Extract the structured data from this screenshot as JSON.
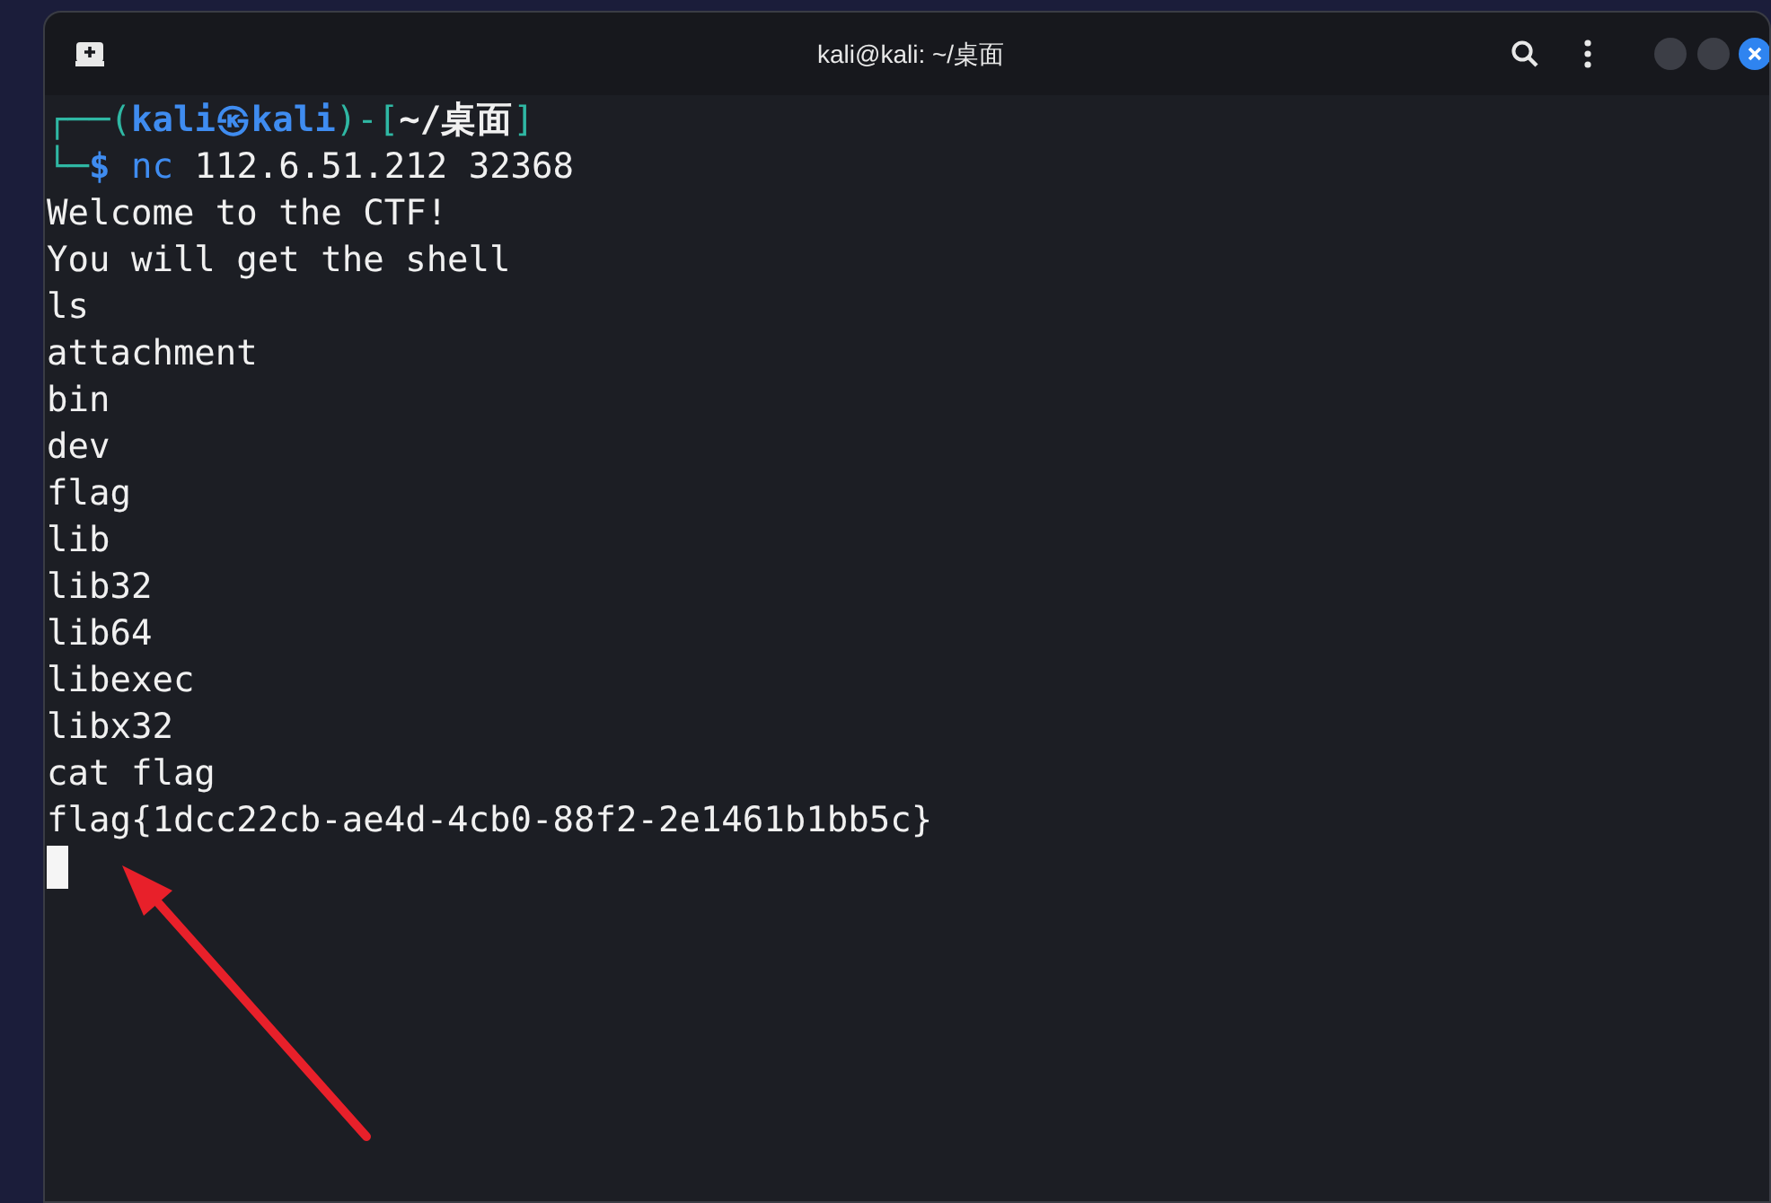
{
  "window": {
    "title": "kali@kali: ~/桌面"
  },
  "terminal": {
    "lines": [
      {
        "kind": "prompt",
        "segments": [
          {
            "text": "┌──(",
            "kind": "frame"
          },
          {
            "text": "kali㉿kali",
            "kind": "user"
          },
          {
            "text": ")-[",
            "kind": "frame"
          },
          {
            "text": "~/桌面",
            "kind": "path"
          },
          {
            "text": "]",
            "kind": "frame"
          }
        ]
      },
      {
        "kind": "prompt",
        "segments": [
          {
            "text": "└─",
            "kind": "frame"
          },
          {
            "text": "$",
            "kind": "user"
          },
          {
            "text": " nc",
            "kind": "command"
          },
          {
            "text": " 112.6.51.212 32368",
            "kind": "plain"
          }
        ]
      },
      {
        "kind": "output",
        "text": "Welcome to the CTF!"
      },
      {
        "kind": "output",
        "text": "You will get the shell"
      },
      {
        "kind": "output",
        "text": "ls"
      },
      {
        "kind": "output",
        "text": "attachment"
      },
      {
        "kind": "output",
        "text": "bin"
      },
      {
        "kind": "output",
        "text": "dev"
      },
      {
        "kind": "output",
        "text": "flag"
      },
      {
        "kind": "output",
        "text": "lib"
      },
      {
        "kind": "output",
        "text": "lib32"
      },
      {
        "kind": "output",
        "text": "lib64"
      },
      {
        "kind": "output",
        "text": "libexec"
      },
      {
        "kind": "output",
        "text": "libx32"
      },
      {
        "kind": "output",
        "text": "cat flag"
      },
      {
        "kind": "output",
        "text": "flag{1dcc22cb-ae4d-4cb0-88f2-2e1461b1bb5c}"
      },
      {
        "kind": "cursor"
      }
    ]
  }
}
